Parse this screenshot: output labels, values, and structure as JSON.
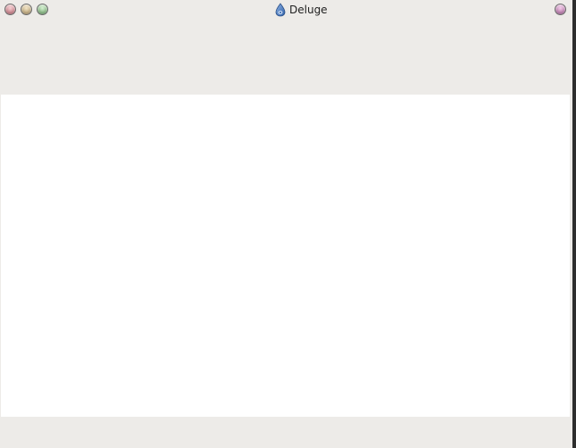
{
  "window": {
    "title": "Deluge",
    "title_icon": "deluge-drop-icon",
    "buttons": [
      "close-icon",
      "minimize-icon",
      "maximize-icon",
      "window-menu-icon"
    ]
  },
  "colors": {
    "chrome": "#edebe8",
    "content": "#ffffff",
    "icon_blue": "#3f6fb5"
  }
}
